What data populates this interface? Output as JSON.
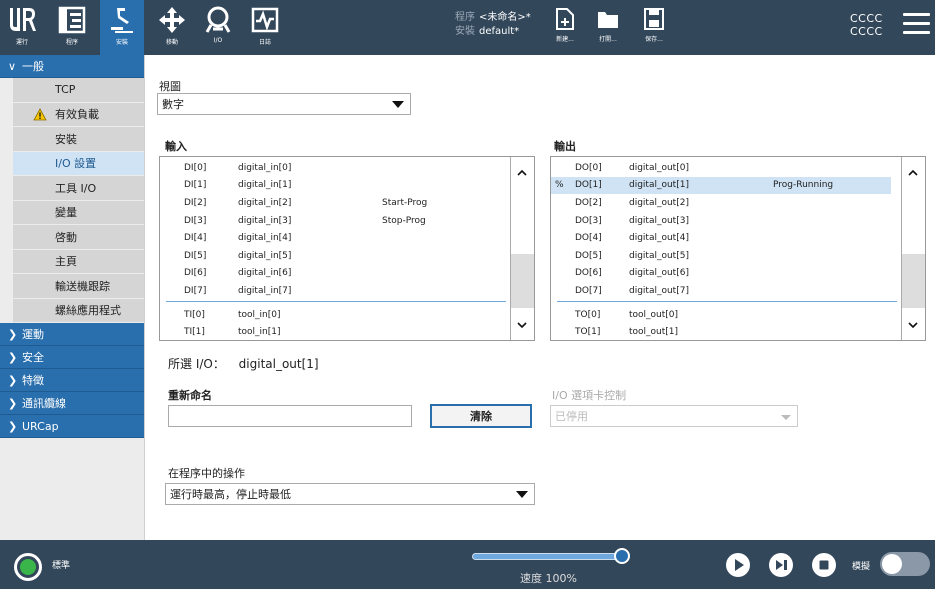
{
  "header": {
    "nav": [
      {
        "id": "run",
        "label": "運行",
        "icon": "ur-logo-icon"
      },
      {
        "id": "program",
        "label": "程序",
        "icon": "program-icon"
      },
      {
        "id": "install",
        "label": "安裝",
        "icon": "installation-icon"
      },
      {
        "id": "move",
        "label": "移動",
        "icon": "move-icon"
      },
      {
        "id": "io",
        "label": "I/O",
        "icon": "io-icon"
      },
      {
        "id": "log",
        "label": "日誌",
        "icon": "log-icon"
      }
    ],
    "program_key": "程序",
    "program_value": "<未命名>*",
    "install_key": "安裝",
    "install_value": "default*",
    "files": [
      {
        "id": "new",
        "label": "新建...",
        "icon": "new-file-icon"
      },
      {
        "id": "open",
        "label": "打開...",
        "icon": "open-folder-icon"
      },
      {
        "id": "save",
        "label": "保存...",
        "icon": "save-icon"
      }
    ],
    "robot_name_1": "CCCC",
    "robot_name_2": "CCCC"
  },
  "sidebar": {
    "general": "一般",
    "items": [
      "TCP",
      "有效負載",
      "安裝",
      "I/O 設置",
      "工具 I/O",
      "變量",
      "啓動",
      "主頁",
      "輸送機跟踪",
      "螺絲應用程式"
    ],
    "active_index": 3,
    "warn_index": 1,
    "sections": [
      "運動",
      "安全",
      "特徵",
      "通訊纜線",
      "URCap"
    ]
  },
  "main": {
    "view_label": "視圖",
    "view_value": "數字",
    "input_title": "輸入",
    "output_title": "輸出",
    "inputs": [
      {
        "port": "DI[0]",
        "name": "digital_in[0]",
        "action": ""
      },
      {
        "port": "DI[1]",
        "name": "digital_in[1]",
        "action": ""
      },
      {
        "port": "DI[2]",
        "name": "digital_in[2]",
        "action": "Start-Prog"
      },
      {
        "port": "DI[3]",
        "name": "digital_in[3]",
        "action": "Stop-Prog"
      },
      {
        "port": "DI[4]",
        "name": "digital_in[4]",
        "action": ""
      },
      {
        "port": "DI[5]",
        "name": "digital_in[5]",
        "action": ""
      },
      {
        "port": "DI[6]",
        "name": "digital_in[6]",
        "action": ""
      },
      {
        "port": "DI[7]",
        "name": "digital_in[7]",
        "action": ""
      },
      {
        "port": "TI[0]",
        "name": "tool_in[0]",
        "action": ""
      },
      {
        "port": "TI[1]",
        "name": "tool_in[1]",
        "action": ""
      }
    ],
    "outputs": [
      {
        "mark": "",
        "port": "DO[0]",
        "name": "digital_out[0]",
        "action": ""
      },
      {
        "mark": "%",
        "port": "DO[1]",
        "name": "digital_out[1]",
        "action": "Prog-Running"
      },
      {
        "mark": "",
        "port": "DO[2]",
        "name": "digital_out[2]",
        "action": ""
      },
      {
        "mark": "",
        "port": "DO[3]",
        "name": "digital_out[3]",
        "action": ""
      },
      {
        "mark": "",
        "port": "DO[4]",
        "name": "digital_out[4]",
        "action": ""
      },
      {
        "mark": "",
        "port": "DO[5]",
        "name": "digital_out[5]",
        "action": ""
      },
      {
        "mark": "",
        "port": "DO[6]",
        "name": "digital_out[6]",
        "action": ""
      },
      {
        "mark": "",
        "port": "DO[7]",
        "name": "digital_out[7]",
        "action": ""
      },
      {
        "mark": "",
        "port": "TO[0]",
        "name": "tool_out[0]",
        "action": ""
      },
      {
        "mark": "",
        "port": "TO[1]",
        "name": "tool_out[1]",
        "action": ""
      }
    ],
    "selected_output_index": 1,
    "selected_io_label": "所選 I/O：",
    "selected_io_value": "digital_out[1]",
    "rename_label": "重新命名",
    "rename_value": "",
    "clear_button": "清除",
    "tab_control_label": "I/O 選項卡控制",
    "tab_control_value": "已停用",
    "action_label": "在程序中的操作",
    "action_value": "運行時最高，停止時最低"
  },
  "footer": {
    "mode_label": "標準",
    "speed_label": "速度 100%",
    "speed_percent": 100,
    "sim_label": "模擬"
  },
  "colors": {
    "header_bg": "#33475a",
    "accent": "#2a6fad",
    "selected_row": "#cfe3f5",
    "power_on": "#39b54a"
  }
}
